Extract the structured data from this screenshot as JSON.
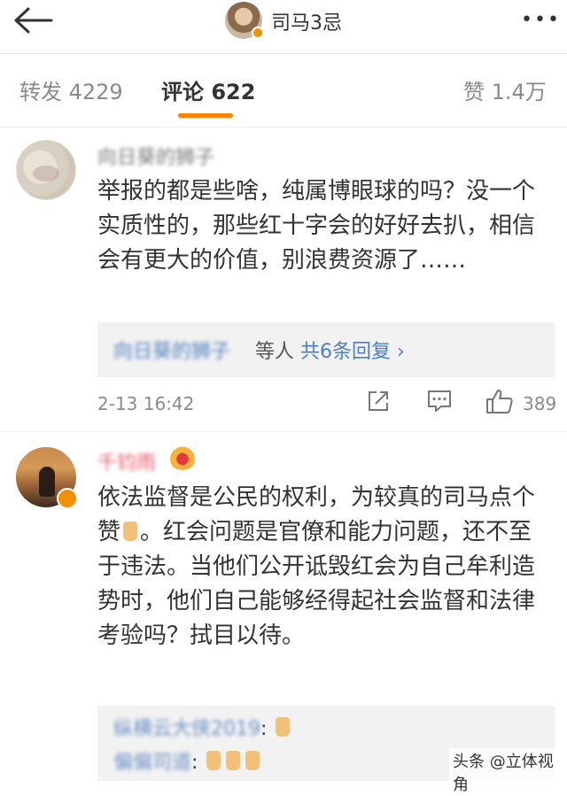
{
  "header": {
    "title": "司马3忌",
    "more_label": "•••"
  },
  "tabs": {
    "repost": "转发 4229",
    "comment": "评论 622",
    "like": "赞 1.4万"
  },
  "comments": [
    {
      "username": "向日葵的狮子",
      "text": "举报的都是些啥，纯属博眼球的吗？没一个实质性的，那些红十字会的好好去扒，相信会有更大的价值，别浪费资源了……",
      "reply_user": "向日葵的狮子",
      "reply_etc": "等人",
      "reply_count": "共6条回复 ›",
      "time": "2-13 16:42",
      "likes": "389"
    },
    {
      "username": "千钧雨",
      "text_part1": "依法监督是公民的权利，为较真的司马点个赞",
      "text_part2": "。红会问题是官僚和能力问题，还不至于违法。当他们公开诋毁红会为自己牟利造势时，他们自己能够经得起社会监督和法律考验吗？拭目以待。",
      "replies": [
        {
          "user": "纵横云大侠2019",
          "suffix": ":"
        },
        {
          "user": "偏偏司道",
          "suffix": ":"
        }
      ]
    }
  ],
  "watermark": "头条 @立体视角",
  "colors": {
    "accent": "#ff8200",
    "link": "#4f7fbf",
    "vip_name": "#e8596b",
    "verified_badge": "#f29100"
  },
  "icons": [
    "back-arrow-icon",
    "more-icon",
    "share-icon",
    "comment-icon",
    "like-icon",
    "thumbs-up-emoji",
    "crown-icon"
  ]
}
